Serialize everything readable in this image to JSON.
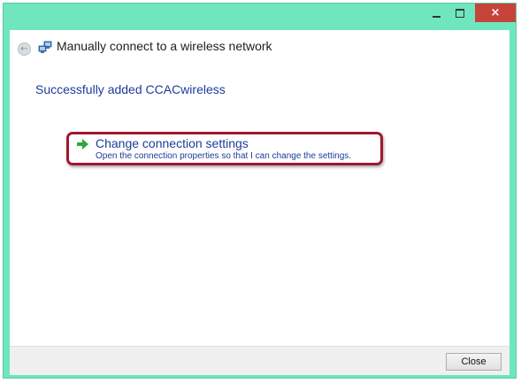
{
  "window": {
    "title": "Manually connect to a wireless network",
    "controls": {
      "minimize": "minimize-icon",
      "maximize": "maximize-icon",
      "close": "×"
    }
  },
  "main": {
    "status_message": "Successfully added CCACwireless",
    "option": {
      "title": "Change connection settings",
      "description": "Open the connection properties so that I can change the settings."
    }
  },
  "footer": {
    "close_label": "Close"
  },
  "colors": {
    "titlebar": "#6fe6be",
    "link_text": "#1c3c9a",
    "highlight_border": "#a3172e",
    "close_button": "#c7443a"
  }
}
